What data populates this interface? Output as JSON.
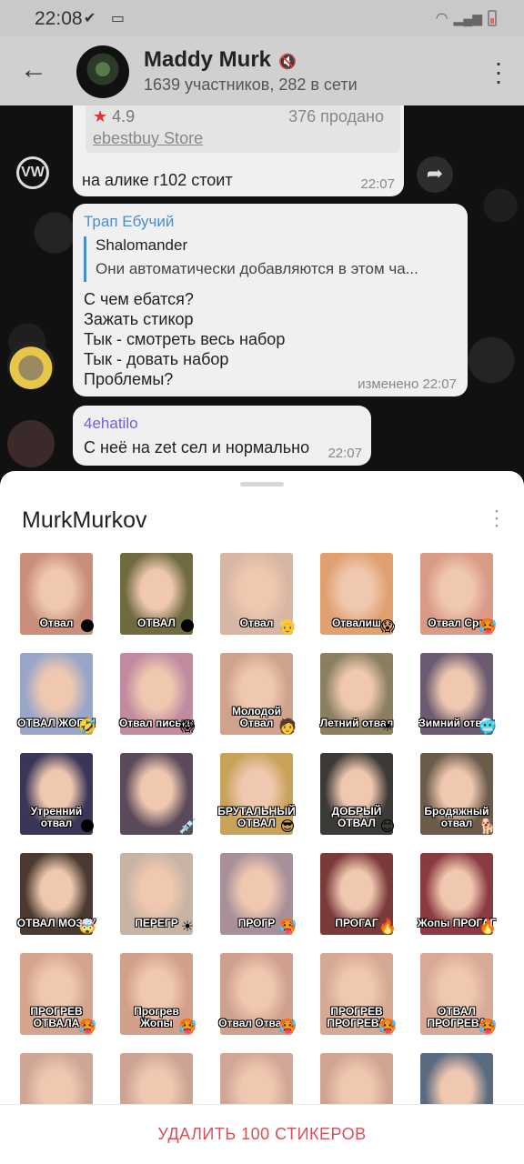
{
  "status_bar": {
    "time": "22:08",
    "icons": "✔ ▭",
    "signal": "wifi signal"
  },
  "header": {
    "title": "Maddy Murk",
    "mute_icon": "🔇",
    "subtitle": "1639 участников, 282 в сети"
  },
  "messages": [
    {
      "product": {
        "rating": "4.9",
        "sold": "376 продано",
        "store": "ebestbuy Store"
      },
      "text": "на алике г102 стоит",
      "time": "22:07"
    },
    {
      "author": "Трап Ебучий",
      "reply_name": "Shalomander",
      "reply_text": "Они автоматически добавляются в этом ча...",
      "lines": [
        "С чем ебатся?",
        "Зажать стикор",
        "Тык - смотреть весь набор",
        "Тык - довать набор",
        "Проблемы?"
      ],
      "time": "изменено 22:07"
    },
    {
      "author": "4ehatilo",
      "text": "С неё на zet сел и нормально",
      "time": "22:07"
    }
  ],
  "sticker_pack": {
    "title": "MurkMurkov",
    "stickers": [
      {
        "cap": "Отвал",
        "emo": "🌑"
      },
      {
        "cap": "ОТВАЛ",
        "emo": "🌑"
      },
      {
        "cap": "Отвал",
        "emo": "👴"
      },
      {
        "cap": "Отвалиш",
        "emo": "😱"
      },
      {
        "cap": "Отвал Сри",
        "emo": "🥵"
      },
      {
        "cap": "ОТВАЛ ЖОПЫ",
        "emo": "🤣"
      },
      {
        "cap": "Отвал письки",
        "emo": "😱"
      },
      {
        "cap": "Молодой Отвал",
        "emo": "🧑"
      },
      {
        "cap": "Летний отвал",
        "emo": "☀"
      },
      {
        "cap": "Зимний отвал",
        "emo": "🥶"
      },
      {
        "cap": "Утренний отвал",
        "emo": "🌑"
      },
      {
        "cap": "",
        "emo": "💉"
      },
      {
        "cap": "БРУТАЛЬНЫЙ ОТВАЛ",
        "emo": "😎"
      },
      {
        "cap": "ДОБРЫЙ ОТВАЛ",
        "emo": "😊"
      },
      {
        "cap": "Бродяжный отвал",
        "emo": "🐕"
      },
      {
        "cap": "ОТВАЛ МОЗГУ",
        "emo": "🤯"
      },
      {
        "cap": "ПЕРЕГР",
        "emo": "☀"
      },
      {
        "cap": "ПРОГР",
        "emo": "🥵"
      },
      {
        "cap": "ПРОГАГ",
        "emo": "🔥"
      },
      {
        "cap": "Жопы ПРОГАГ",
        "emo": "🔥"
      },
      {
        "cap": "ПРОГРЕВ ОТВАЛА",
        "emo": "🥵"
      },
      {
        "cap": "Прогрев Жопы",
        "emo": "🥵"
      },
      {
        "cap": "Отвал Отвала",
        "emo": "🥵"
      },
      {
        "cap": "ПРОГРЕВ ПРОГРЕВА",
        "emo": "🥵"
      },
      {
        "cap": "ОТВАЛ ПРОГРЕВА",
        "emo": "🥵"
      },
      {
        "cap": "",
        "emo": ""
      },
      {
        "cap": "",
        "emo": ""
      },
      {
        "cap": "",
        "emo": ""
      },
      {
        "cap": "",
        "emo": ""
      },
      {
        "cap": "",
        "emo": ""
      }
    ]
  },
  "footer": {
    "delete_label": "УДАЛИТЬ 100 СТИКЕРОВ"
  },
  "colors": {
    "accent_blue": "#4a8ec9",
    "accent_purple": "#7a5ed1",
    "delete_red": "#d6505a"
  }
}
